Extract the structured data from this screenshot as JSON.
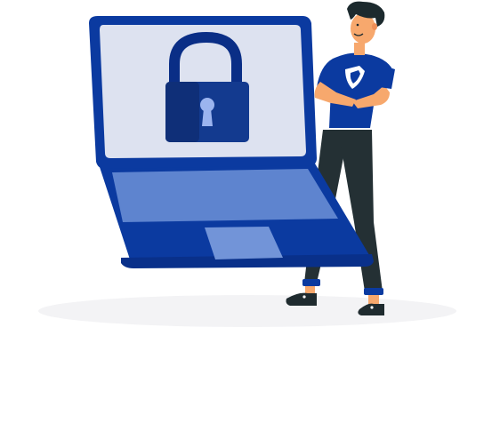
{
  "illustration": {
    "subject": "person-standing-beside-locked-laptop",
    "icons": [
      "padlock-icon",
      "laptop-icon",
      "shield-logo-icon"
    ]
  },
  "colors": {
    "background": "#ffffff",
    "laptop_frame": "#0b3aa0",
    "laptop_frame_dark": "#09308a",
    "screen": "#dde2f0",
    "keyboard_deck": "#5e84cf",
    "touchpad": "#7294d8",
    "lock_body": "#133a8f",
    "lock_body_shade": "#0f2f78",
    "lock_shackle": "#0a2e86",
    "keyhole": "#9bb4ef",
    "shirt": "#0b3aa0",
    "pants": "#243034",
    "skin": "#f7a86d",
    "hair": "#1c2a2e",
    "shoes": "#1f2b2f",
    "shadow": "#f1f1f3"
  }
}
